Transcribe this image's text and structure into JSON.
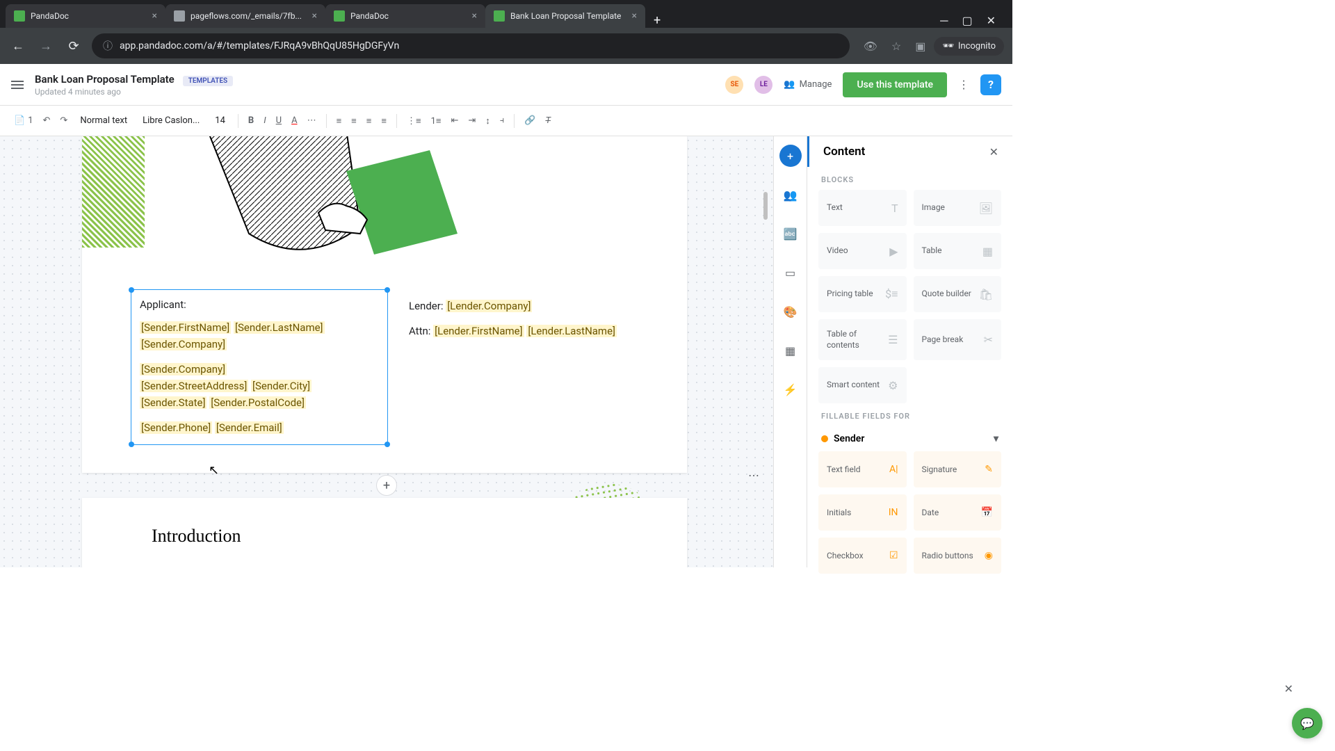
{
  "browser": {
    "tabs": [
      {
        "title": "PandaDoc",
        "favicon": "green",
        "active": false
      },
      {
        "title": "pageflows.com/_emails/7fb...",
        "favicon": "gray",
        "active": false
      },
      {
        "title": "PandaDoc",
        "favicon": "green",
        "active": false
      },
      {
        "title": "Bank Loan Proposal Template",
        "favicon": "green",
        "active": true
      }
    ],
    "url": "app.pandadoc.com/a/#/templates/FJRqA9vBhQqU85HgDGFyVn",
    "incognito_label": "Incognito"
  },
  "header": {
    "doc_title": "Bank Loan Proposal Template",
    "badge": "TEMPLATES",
    "updated": "Updated 4 minutes ago",
    "avatars": [
      "SE",
      "LE"
    ],
    "manage_label": "Manage",
    "use_template_label": "Use this template",
    "help_label": "?"
  },
  "toolbar": {
    "pages": "1",
    "style_select": "Normal text",
    "font_select": "Libre Caslon...",
    "font_size": "14"
  },
  "document": {
    "applicant_label": "Applicant:",
    "lender_label": "Lender:",
    "attn_label": "Attn:",
    "tokens": {
      "sender_first": "[Sender.FirstName]",
      "sender_last": "[Sender.LastName]",
      "sender_company": "[Sender.Company]",
      "sender_company2": "[Sender.Company]",
      "sender_street": "[Sender.StreetAddress]",
      "sender_city": "[Sender.City]",
      "sender_state": "[Sender.State]",
      "sender_postal": "[Sender.PostalCode]",
      "sender_phone": "[Sender.Phone]",
      "sender_email": "[Sender.Email]",
      "lender_company": "[Lender.Company]",
      "lender_first": "[Lender.FirstName]",
      "lender_last": "[Lender.LastName]"
    },
    "intro_heading": "Introduction"
  },
  "panel": {
    "title": "Content",
    "blocks_label": "BLOCKS",
    "blocks": [
      {
        "label": "Text"
      },
      {
        "label": "Image"
      },
      {
        "label": "Video"
      },
      {
        "label": "Table"
      },
      {
        "label": "Pricing table"
      },
      {
        "label": "Quote builder"
      },
      {
        "label": "Table of contents"
      },
      {
        "label": "Page break"
      },
      {
        "label": "Smart content"
      }
    ],
    "fillable_label": "FILLABLE FIELDS FOR",
    "sender_label": "Sender",
    "fields": [
      {
        "label": "Text field"
      },
      {
        "label": "Signature"
      },
      {
        "label": "Initials"
      },
      {
        "label": "Date"
      },
      {
        "label": "Checkbox"
      },
      {
        "label": "Radio buttons"
      }
    ]
  }
}
